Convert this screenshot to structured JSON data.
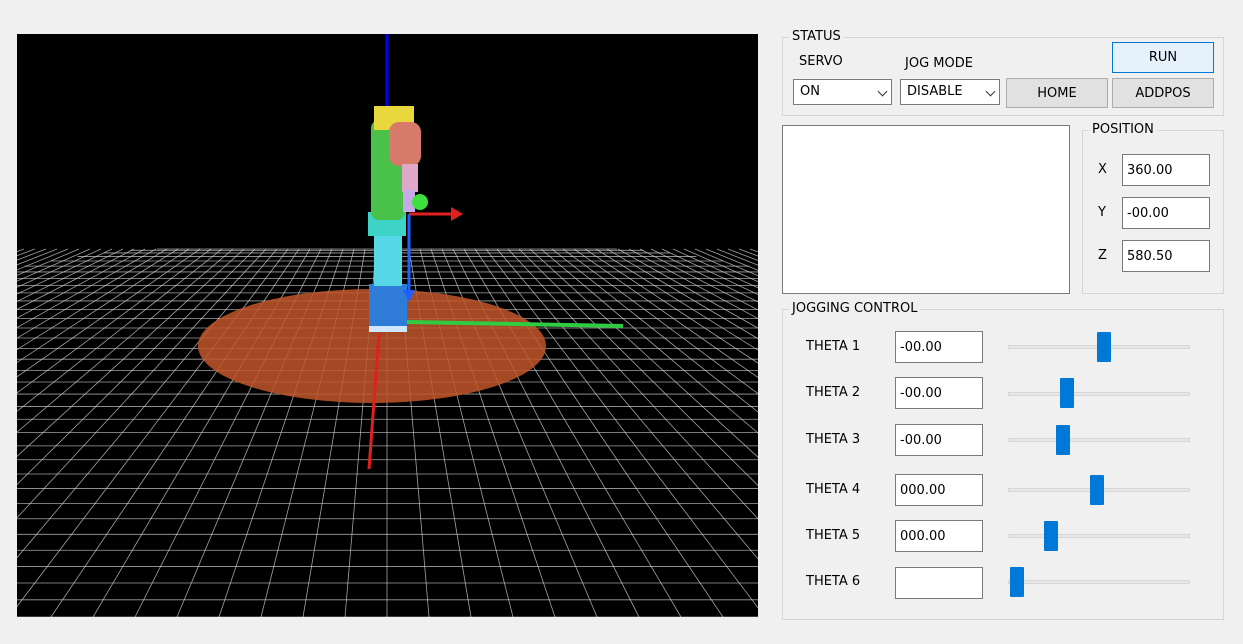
{
  "status": {
    "title": "STATUS",
    "servo_label": "SERVO",
    "servo_value": "ON",
    "jog_mode_label": "JOG MODE",
    "jog_mode_value": "DISABLE",
    "run_label": "RUN",
    "home_label": "HOME",
    "addpos_label": "ADDPOS"
  },
  "log_box": {
    "text": ""
  },
  "position": {
    "title": "POSITION",
    "x_label": "X",
    "x_value": "360.00",
    "y_label": "Y",
    "y_value": "-00.00",
    "z_label": "Z",
    "z_value": "580.50"
  },
  "jogging": {
    "title": "JOGGING CONTROL",
    "joints": [
      {
        "label": "THETA 1",
        "value": "-00.00",
        "slider": 0.53
      },
      {
        "label": "THETA 2",
        "value": "-00.00",
        "slider": 0.32
      },
      {
        "label": "THETA 3",
        "value": "-00.00",
        "slider": 0.3
      },
      {
        "label": "THETA 4",
        "value": "000.00",
        "slider": 0.49
      },
      {
        "label": "THETA 5",
        "value": "000.00",
        "slider": 0.23
      },
      {
        "label": "THETA 6",
        "value": "",
        "slider": 0.04
      }
    ]
  },
  "colors": {
    "slider_thumb": "#0078d7",
    "base_disc": "#c2562a",
    "grid": "#d8d8d8",
    "axis_x": "#e02020",
    "axis_y": "#2ecc40",
    "axis_z": "#0000ff"
  }
}
